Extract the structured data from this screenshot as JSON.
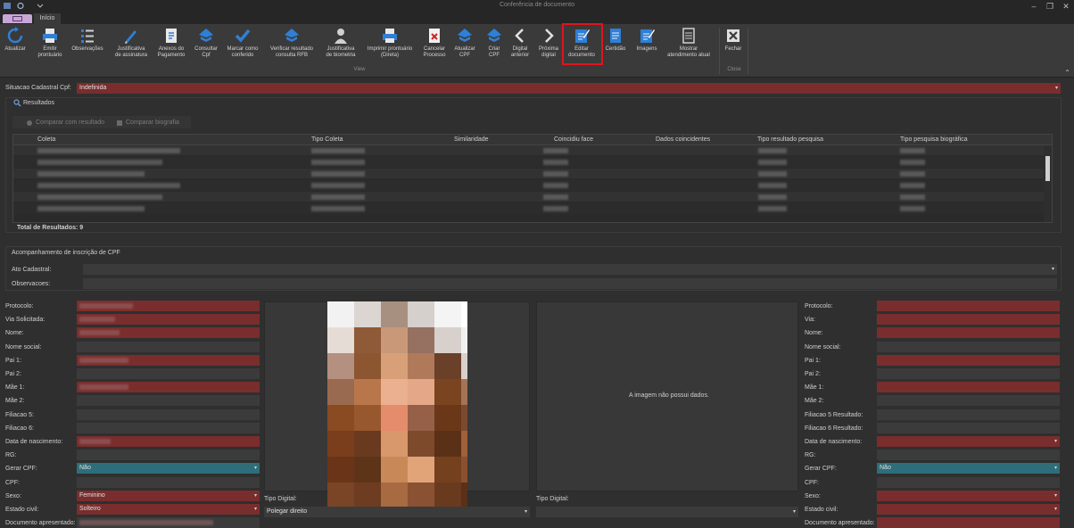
{
  "window": {
    "title": "Conferência de documento"
  },
  "tabs": {
    "home": "Início"
  },
  "ribbon": {
    "buttons": [
      {
        "id": "atualizar",
        "label": "Atualizar",
        "icon": "refresh-icon"
      },
      {
        "id": "emitir",
        "label": "Emitir\nprontuário",
        "icon": "printer-icon"
      },
      {
        "id": "observacoes",
        "label": "Observações",
        "icon": "list-icon"
      },
      {
        "id": "just-assinatura",
        "label": "Justificativa\nde assinatura",
        "icon": "pen-icon"
      },
      {
        "id": "anexos",
        "label": "Anexos do\nPagamento",
        "icon": "attachment-icon"
      },
      {
        "id": "consultar-cpf",
        "label": "Consultar\nCpf",
        "icon": "receita-icon"
      },
      {
        "id": "marcar",
        "label": "Marcar como\nconferido",
        "icon": "check-icon"
      },
      {
        "id": "verificar",
        "label": "Verificar resultado\nconsulta RFB",
        "icon": "receita-icon"
      },
      {
        "id": "just-biometria",
        "label": "Justificativa\nde biometria",
        "icon": "person-icon"
      },
      {
        "id": "imprimir",
        "label": "Imprimir prontuário\n(Direta)",
        "icon": "printer-icon"
      },
      {
        "id": "cancelar",
        "label": "Cancelar\nProcesso",
        "icon": "cancel-doc-icon"
      },
      {
        "id": "atualizar-cpf",
        "label": "Atualizar\nCPF",
        "icon": "receita-icon"
      },
      {
        "id": "criar-cpf",
        "label": "Criar\nCPF",
        "icon": "receita-icon"
      },
      {
        "id": "digital-anterior",
        "label": "Digital\nanterior",
        "icon": "chevron-left-icon"
      },
      {
        "id": "proxima-digital",
        "label": "Próxima\ndigital",
        "icon": "chevron-right-icon"
      },
      {
        "id": "editar",
        "label": "Editar\ndocumento",
        "icon": "edit-doc-icon"
      },
      {
        "id": "certidao",
        "label": "Certidão",
        "icon": "document-icon"
      },
      {
        "id": "imagens",
        "label": "Imagens",
        "icon": "edit-doc-icon"
      },
      {
        "id": "mostrar",
        "label": "Mostrar\natendimento atual",
        "icon": "form-icon"
      },
      {
        "id": "fechar",
        "label": "Fechar",
        "icon": "close-box-icon"
      }
    ],
    "group_view": "View",
    "group_close": "Close"
  },
  "situacao": {
    "label": "Situacao Cadastral Cpf:",
    "value": "Indefinida"
  },
  "resultados": {
    "header": "Resultados",
    "compare_result": "Comparar com resultado",
    "compare_bio": "Comparar biografia",
    "columns": [
      "Coleta",
      "Tipo Coleta",
      "Similaridade",
      "Coincidiu face",
      "Dados coincidentes",
      "Tipo resultado pesquisa",
      "Tipo pesquisa biográfica"
    ],
    "total": "Total de Resultados: 9"
  },
  "acompanhamento": {
    "header": "Acompanhamento de inscrição de CPF",
    "ato_label": "Ato Cadastral:",
    "obs_label": "Observacoes:"
  },
  "left_form": {
    "protocolo": "Protocolo:",
    "via": "Via Solicitada:",
    "nome": "Nome:",
    "nome_social": "Nome social:",
    "pai1": "Pai 1:",
    "pai2": "Pai 2:",
    "mae1": "Mãe 1:",
    "mae2": "Mãe 2:",
    "filiacao5": "Filiacao 5:",
    "filiacao6": "Filiacao 6:",
    "nascimento": "Data de nascimento:",
    "rg": "RG:",
    "gerar_cpf": "Gerar CPF:",
    "gerar_cpf_value": "Não",
    "cpf": "CPF:",
    "sexo": "Sexo:",
    "sexo_value": "Feminino",
    "estado_civil": "Estado civil:",
    "estado_civil_value": "Solteiro",
    "documento": "Documento apresentado:"
  },
  "center": {
    "tipo_digital_1": "Tipo Digital:",
    "tipo_digital_1_value": "Polegar direito",
    "no_image": "A imagem não possui dados.",
    "tipo_digital_2": "Tipo Digital:"
  },
  "right_form": {
    "protocolo": "Protocolo:",
    "via": "Via:",
    "nome": "Nome:",
    "nome_social": "Nome social:",
    "pai1": "Pai 1:",
    "pai2": "Pai 2:",
    "mae1": "Mãe 1:",
    "mae2": "Mãe 2:",
    "filiacao5": "Filiacao 5 Resultado:",
    "filiacao6": "Filiacao 6 Resultado:",
    "nascimento": "Data de nascimento:",
    "rg": "RG:",
    "gerar_cpf": "Gerar CPF:",
    "gerar_cpf_value": "Não",
    "cpf": "CPF:",
    "sexo": "Sexo:",
    "estado_civil": "Estado civil:",
    "documento": "Documento apresentado:"
  },
  "colors": {
    "accent_red": "#7a2d2d",
    "highlight": "#e0141e",
    "teal": "#2d6e7a",
    "icon_blue": "#2f7fd6"
  }
}
